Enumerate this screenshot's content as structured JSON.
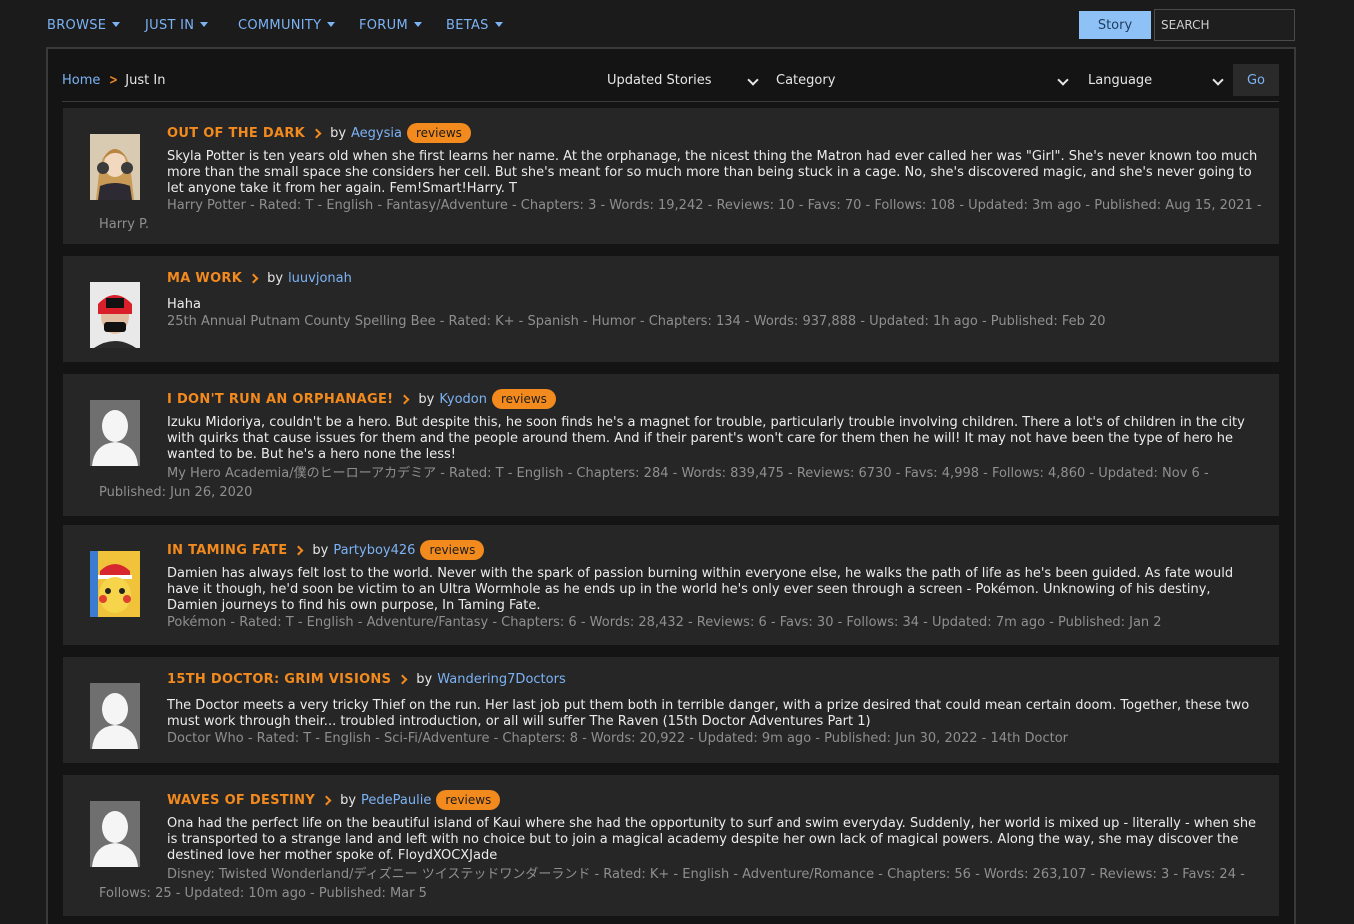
{
  "nav": {
    "items": [
      "BROWSE",
      "JUST IN",
      "COMMUNITY",
      "FORUM",
      "BETAS"
    ],
    "story_button": "Story",
    "search_placeholder": "SEARCH"
  },
  "breadcrumb": {
    "home": "Home",
    "current": "Just In"
  },
  "filters": {
    "updated": "Updated Stories",
    "category": "Category",
    "language": "Language",
    "go": "Go"
  },
  "reviews_label": "reviews",
  "by_label": "by",
  "stories": [
    {
      "title": "OUT OF THE DARK",
      "author": "Aegysia",
      "has_reviews": true,
      "avatar": "anime-girl",
      "summary": "Skyla Potter is ten years old when she first learns her name. At the orphanage, the nicest thing the Matron had ever called her was \"Girl\". She's never known too much more than the small space she considers her cell. But she's meant for so much more than being stuck in a cage. No, she's discovered magic, and she's never going to let anyone take it from her again. Fem!Smart!Harry. T",
      "meta": "Harry Potter - Rated: T - English - Fantasy/Adventure - Chapters: 3 - Words: 19,242 - Reviews: 10 - Favs: 70 - Follows: 108 - Updated: 3m ago - Published: Aug 15, 2021 - Harry P."
    },
    {
      "title": "MA WORK",
      "author": "luuvjonah",
      "has_reviews": false,
      "avatar": "person-red-cap",
      "summary": "Haha",
      "meta": "25th Annual Putnam County Spelling Bee - Rated: K+ - Spanish - Humor - Chapters: 134 - Words: 937,888 - Updated: 1h ago - Published: Feb 20"
    },
    {
      "title": "I DON'T RUN AN ORPHANAGE!",
      "author": "Kyodon",
      "has_reviews": true,
      "avatar": "default-silhouette",
      "summary": "Izuku Midoriya, couldn't be a hero. But despite this, he soon finds he's a magnet for trouble, particularly trouble involving children. There a lot's of children in the city with quirks that cause issues for them and the people around them. And if their parent's won't care for them then he will! It may not have been the type of hero he wanted to be. But he's a hero none the less!",
      "meta": "My Hero Academia/僕のヒーローアカデミア - Rated: T - English - Chapters: 284 - Words: 839,475 - Reviews: 6730 - Favs: 4,998 - Follows: 4,860 - Updated: Nov 6 - Published: Jun 26, 2020"
    },
    {
      "title": "IN TAMING FATE",
      "author": "Partyboy426",
      "has_reviews": true,
      "avatar": "pikachu",
      "summary": "Damien has always felt lost to the world. Never with the spark of passion burning within everyone else, he walks the path of life as he's been guided. As fate would have it though, he'd soon be victim to an Ultra Wormhole as he ends up in the world he's only ever seen through a screen - Pokémon. Unknowing of his destiny, Damien journeys to find his own purpose, In Taming Fate.",
      "meta": "Pokémon - Rated: T - English - Adventure/Fantasy - Chapters: 6 - Words: 28,432 - Reviews: 6 - Favs: 30 - Follows: 34 - Updated: 7m ago - Published: Jan 2"
    },
    {
      "title": "15TH DOCTOR: GRIM VISIONS",
      "author": "Wandering7Doctors",
      "has_reviews": false,
      "avatar": "default-silhouette",
      "summary": "The Doctor meets a very tricky Thief on the run. Her last job put them both in terrible danger, with a prize desired that could mean certain doom. Together, these two must work through their... troubled introduction, or all will suffer The Raven (15th Doctor Adventures Part 1)",
      "meta": "Doctor Who - Rated: T - English - Sci-Fi/Adventure - Chapters: 8 - Words: 20,922 - Updated: 9m ago - Published: Jun 30, 2022 - 14th Doctor"
    },
    {
      "title": "WAVES OF DESTINY",
      "author": "PedePaulie",
      "has_reviews": true,
      "avatar": "default-silhouette",
      "summary": "Ona had the perfect life on the beautiful island of Kaui where she had the opportunity to surf and swim everyday. Suddenly, her world is mixed up - literally - when she is transported to a strange land and left with no choice but to join a magical academy despite her own lack of magical powers. Along the way, she may discover the destined love her mother spoke of. FloydXOCXJade",
      "meta": "Disney: Twisted Wonderland/ディズニー ツイステッドワンダーランド - Rated: K+ - English - Adventure/Romance - Chapters: 56 - Words: 263,107 - Reviews: 3 - Favs: 24 - Follows: 25 - Updated: 10m ago - Published: Mar 5"
    }
  ]
}
